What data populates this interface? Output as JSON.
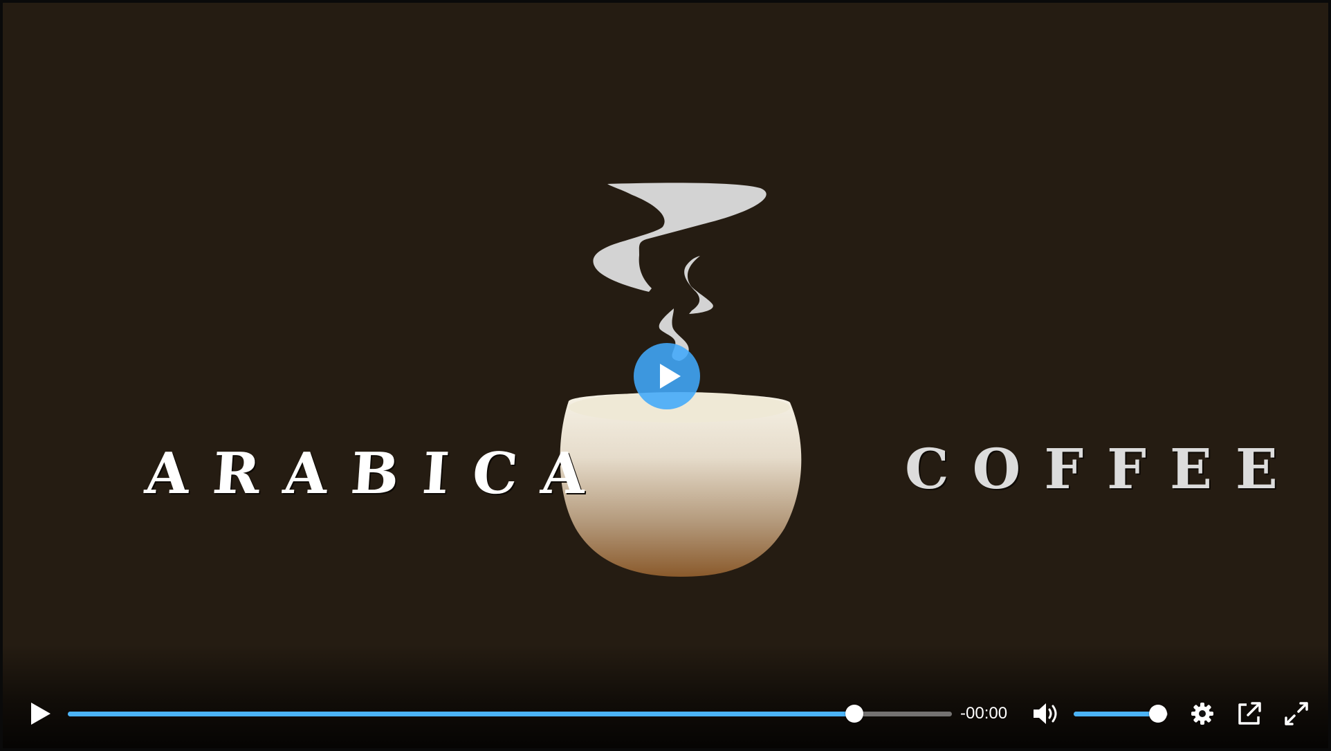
{
  "video": {
    "poster": {
      "word_left": "ARABICA",
      "word_right": "COFFEE",
      "colors": {
        "background": "#251c12",
        "steam": "#d3d3d3",
        "cup_top": "#f4f0e4",
        "cup_bottom": "#8a5a2c"
      }
    },
    "overlay": {
      "big_play_icon": "play-icon",
      "accent_color": "#41a8fa"
    }
  },
  "controls": {
    "play_icon": "play-icon",
    "progress_fraction": 0.89,
    "time_display": "-00:00",
    "volume_icon": "volume-icon",
    "volume_fraction": 0.9,
    "settings_icon": "gear-icon",
    "popout_icon": "external-link-icon",
    "fullscreen_icon": "expand-icon",
    "accent_color": "#4bb3f7"
  }
}
